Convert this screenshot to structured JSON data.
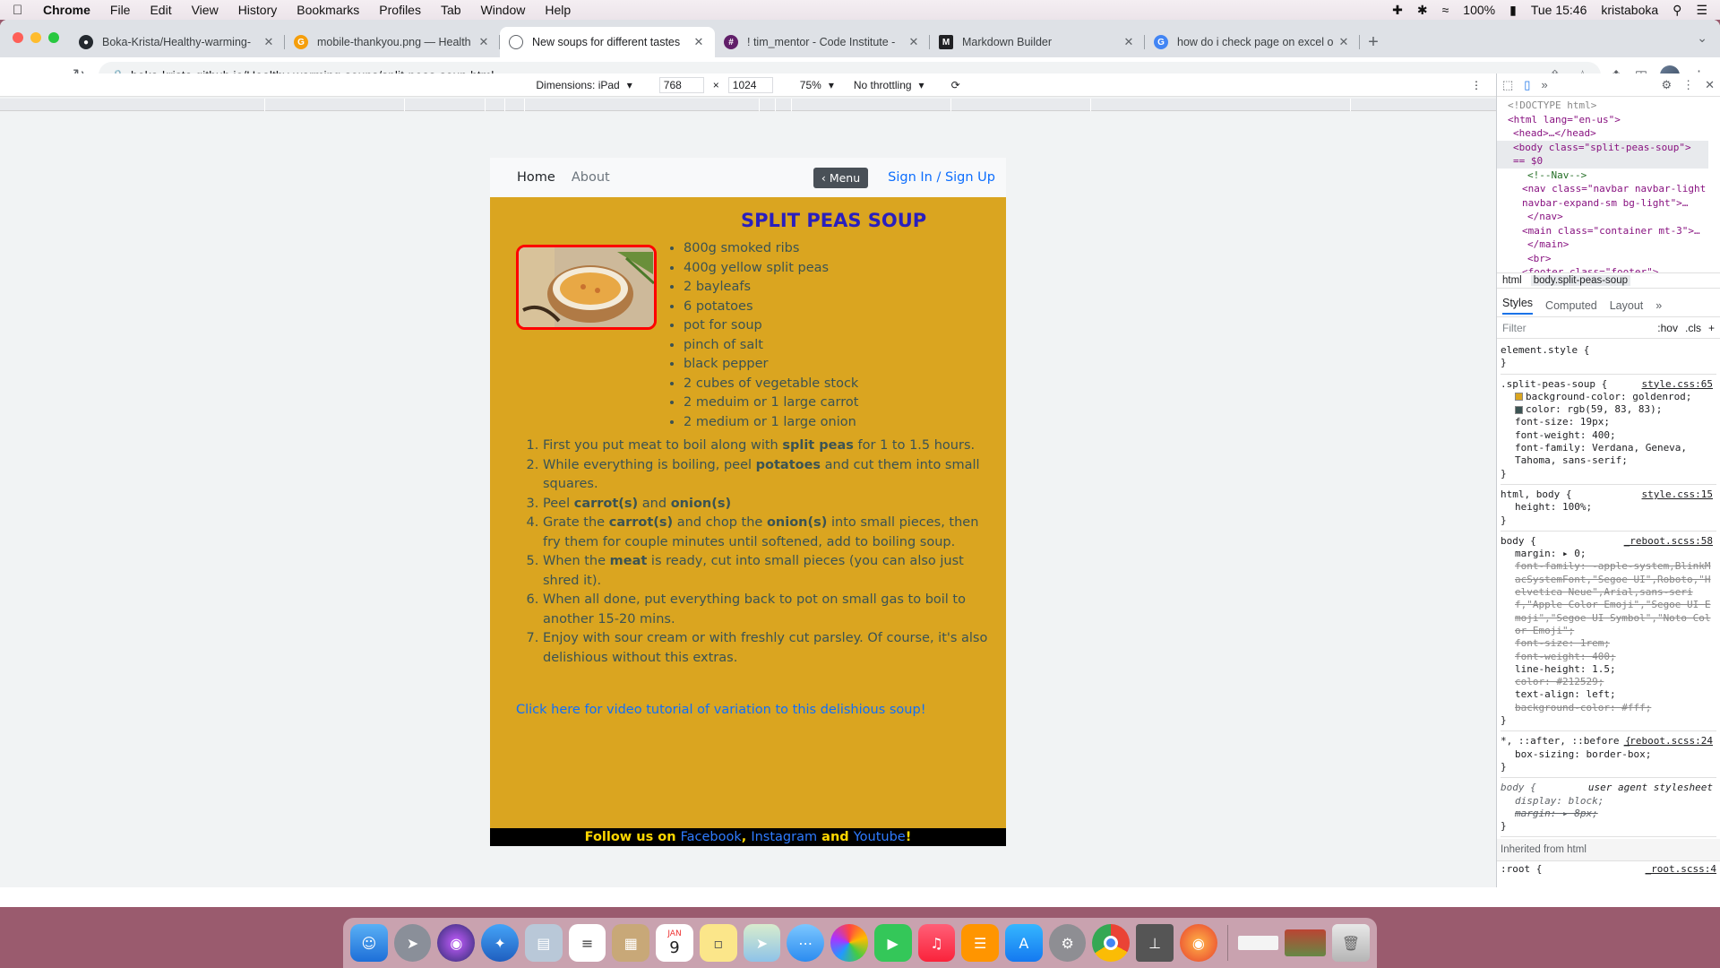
{
  "menubar": {
    "app": "Chrome",
    "items": [
      "File",
      "Edit",
      "View",
      "History",
      "Bookmarks",
      "Profiles",
      "Tab",
      "Window",
      "Help"
    ],
    "battery": "100%",
    "datetime": "Tue 15:46",
    "user": "kristaboka"
  },
  "browser": {
    "tabs": [
      {
        "title": "Boka-Krista/Healthy-warming-",
        "icon": "github-icon",
        "color": "#24292f"
      },
      {
        "title": "mobile-thankyou.png — Health",
        "icon": "gitpod-icon",
        "color": "#f59e0b"
      },
      {
        "title": "New soups for different tastes",
        "icon": "globe-icon",
        "color": "#5f6368"
      },
      {
        "title": "! tim_mentor - Code Institute -",
        "icon": "slack-icon",
        "color": "#611f69"
      },
      {
        "title": "Markdown Builder",
        "icon": "markdown-icon",
        "color": "#202124"
      },
      {
        "title": "how do i check page on excel o",
        "icon": "google-icon",
        "color": "#4285f4"
      }
    ],
    "url": "boka-krista.github.io/Healthy-warming-soups/split-peas-soup.html"
  },
  "device_toolbar": {
    "dimensions_label": "Dimensions: iPad",
    "width": "768",
    "x": "×",
    "height": "1024",
    "zoom": "75%",
    "throttling": "No throttling"
  },
  "site": {
    "nav": {
      "home": "Home",
      "about": "About",
      "menu": "‹ Menu",
      "signin": "Sign In / Sign Up"
    },
    "title": "SPLIT PEAS SOUP",
    "ingredients": [
      "800g smoked ribs",
      "400g yellow split peas",
      "2 bayleafs",
      "6 potatoes",
      "pot for soup",
      "pinch of salt",
      "black pepper",
      "2 cubes of vegetable stock",
      "2 meduim or 1 large carrot",
      "2 medium or 1 large onion"
    ],
    "steps": [
      {
        "parts": [
          "First you put meat to boil along with ",
          "split peas",
          " for 1 to 1.5 hours."
        ]
      },
      {
        "parts": [
          "While everything is boiling, peel ",
          "potatoes",
          " and cut them into small squares."
        ]
      },
      {
        "parts": [
          "Peel ",
          "carrot(s)",
          " and ",
          "onion(s)",
          ""
        ]
      },
      {
        "parts": [
          "Grate the ",
          "carrot(s)",
          " and chop the ",
          "onion(s)",
          " into small pieces, then fry them for couple minutes until softened, add to boiling soup."
        ]
      },
      {
        "parts": [
          "When the ",
          "meat",
          " is ready, cut into small pieces (you can also just shred it)."
        ]
      },
      {
        "parts": [
          "When all done, put everything back to pot on small gas to boil to another 15-20 mins."
        ]
      },
      {
        "parts": [
          "Enjoy with sour cream or with freshly cut parsley. Of course, it's also delishious without this extras."
        ]
      }
    ],
    "video_link": "Click here for video tutorial of variation to this delishious soup!",
    "footer": {
      "prefix": "Follow us on ",
      "facebook": "Facebook",
      "comma": ", ",
      "instagram": "Instagram",
      "and": " and ",
      "youtube": "Youtube",
      "suffix": "!"
    }
  },
  "devtools": {
    "dom": [
      "<!DOCTYPE html>",
      "<html lang=\"en-us\">",
      "<head>…</head>",
      "<body class=\"split-peas-soup\"> == $0",
      "<!--Nav-->",
      "<nav class=\"navbar navbar-light navbar-expand-sm bg-light\">…",
      "</nav>",
      "<main class=\"container mt-3\">…",
      "</main>",
      "<br>",
      "<footer class=\"footer\">…"
    ],
    "crumbs": [
      "html",
      "body.split-peas-soup"
    ],
    "tabs": [
      "Styles",
      "Computed",
      "Layout"
    ],
    "filter_placeholder": "Filter",
    "hov": ":hov",
    "cls": ".cls",
    "element_style": "element.style {",
    "rules": [
      {
        "selector": ".split-peas-soup {",
        "src": "style.css:65",
        "props": [
          "background-color: goldenrod;",
          "color: rgb(59, 83, 83);",
          "font-size: 19px;",
          "font-weight: 400;",
          "font-family: Verdana, Geneva, Tahoma, sans-serif;"
        ]
      },
      {
        "selector": "html, body {",
        "src": "style.css:15",
        "props": [
          "height: 100%;"
        ]
      },
      {
        "selector": "body {",
        "src": "_reboot.scss:58",
        "props": [
          "margin: ▸ 0;",
          "font-family: -apple-system,BlinkMacSystemFont,\"Segoe UI\",Roboto,\"Helvetica Neue\",Arial,sans-serif,\"Apple Color Emoji\",\"Segoe UI Emoji\",\"Segoe UI Symbol\",\"Noto Color Emoji\";",
          "font-size: 1rem;",
          "font-weight: 400;",
          "line-height: 1.5;",
          "color: #212529;",
          "text-align: left;",
          "background-color: #fff;"
        ]
      },
      {
        "selector": "*, ::after, ::before {",
        "src": "_reboot.scss:24",
        "props": [
          "box-sizing: border-box;"
        ]
      },
      {
        "selector": "body {",
        "src": "user agent stylesheet",
        "props": [
          "display: block;",
          "margin: ▸ 8px;"
        ]
      }
    ],
    "inherited": "Inherited from html",
    "root": ":root {",
    "root_src": "_root.scss:4"
  },
  "dock_apps": [
    "Finder",
    "Launchpad",
    "Siri",
    "Safari",
    "Preview",
    "Reminders",
    "Notes",
    "Calendar",
    "Stickies",
    "Maps",
    "Messages",
    "Photos",
    "FaceTime",
    "Music",
    "Books",
    "App Store",
    "System Preferences",
    "Chrome",
    "Instruments",
    "Firefox",
    "Downloads",
    "Screenshot",
    "Trash"
  ],
  "calendar_day": "9",
  "calendar_month": "JAN"
}
